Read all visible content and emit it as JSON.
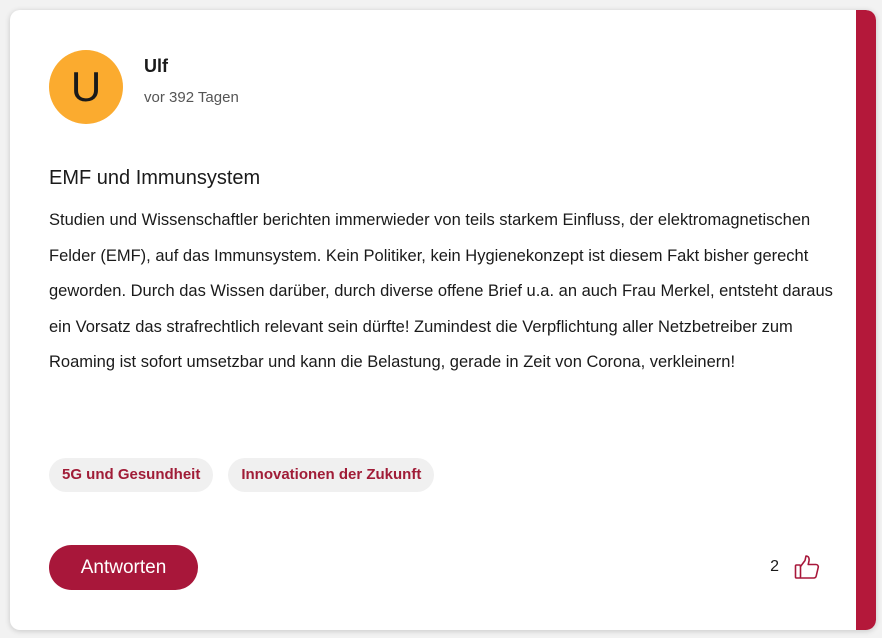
{
  "post": {
    "avatar_letter": "U",
    "author": "Ulf",
    "time": "vor 392 Tagen",
    "title": "EMF und Immunsystem",
    "body": "Studien und Wissenschaftler berichten immerwieder von teils starkem Einfluss, der elektromagnetischen Felder (EMF), auf das Immunsystem. Kein Politiker, kein Hygienekonzept ist diesem Fakt bisher gerecht geworden. Durch das Wissen darüber, durch diverse offene Brief u.a. an auch Frau Merkel, entsteht daraus ein Vorsatz das strafrechtlich relevant sein dürfte! Zumindest die Verpflichtung aller Netzbetreiber zum Roaming ist sofort umsetzbar und kann die Belastung, gerade in Zeit von Corona, verkleinern!",
    "tags": [
      "5G und Gesundheit",
      "Innovationen der Zukunft"
    ],
    "reply_label": "Antworten",
    "like_count": "2",
    "like_icon": "thumbs-up-icon"
  },
  "colors": {
    "accent": "#b4183a",
    "avatar_bg": "#fbab2f",
    "tag_text": "#a01c37",
    "tag_bg": "#f0f0f0"
  }
}
